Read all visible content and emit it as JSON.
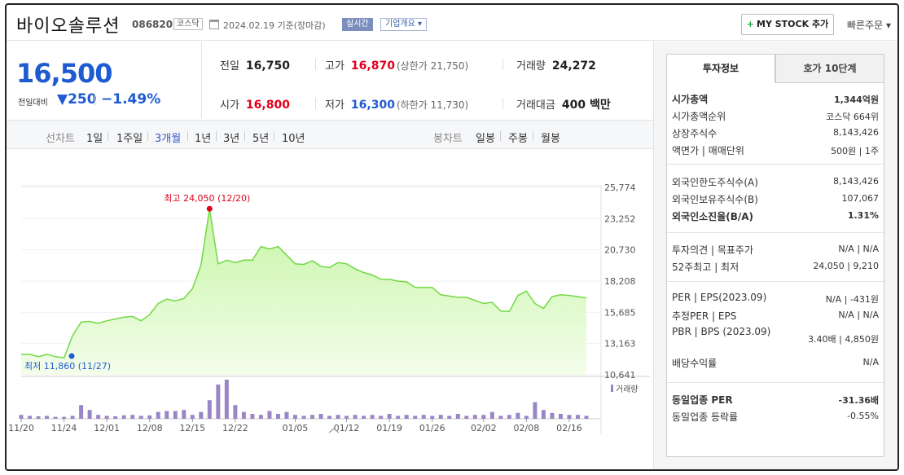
{
  "header": {
    "name": "바이오솔루션",
    "code": "086820",
    "market": "코스닥",
    "date": "2024.02.19  기준(장마감)",
    "realtime": "실시간",
    "overview": "기업개요 ▾",
    "mystock": "MY STOCK 추가",
    "quick_order": "빠른주문 ▾"
  },
  "price": {
    "current": "16,500",
    "change_label": "전일대비",
    "change": "▼250",
    "change_pct": "−1.49%"
  },
  "stats": {
    "prev_close": {
      "label": "전일",
      "value": "16,750"
    },
    "high": {
      "label": "고가",
      "value": "16,870",
      "sub": "(상한가 21,750)"
    },
    "volume": {
      "label": "거래량",
      "value": "24,272"
    },
    "open": {
      "label": "시가",
      "value": "16,800"
    },
    "low": {
      "label": "저가",
      "value": "16,300",
      "sub": "(하한가 11,730)"
    },
    "trade_value": {
      "label": "거래대금",
      "value": "400 백만"
    }
  },
  "periods": {
    "line_label": "선차트",
    "line": [
      "1일",
      "1주일",
      "3개월",
      "1년",
      "3년",
      "5년",
      "10년"
    ],
    "selected": "3개월",
    "candle_label": "봉차트",
    "candle": [
      "일봉",
      "주봉",
      "월봉"
    ]
  },
  "colors": {
    "up": "#e0001b",
    "down": "#1e5bd1",
    "area_fill": "#c6f5a4",
    "area_line": "#72d844",
    "volume_bar": "#9a86c6"
  },
  "chart_data": {
    "type": "area",
    "y_ticks": [
      "25,774",
      "23,252",
      "20,730",
      "18,208",
      "15,685",
      "13,163",
      "10,641"
    ],
    "ylim": [
      10641,
      25774
    ],
    "x_ticks": [
      "11/20",
      "11/24",
      "12/01",
      "12/08",
      "12/15",
      "12/22",
      "01/05",
      "01/12",
      "01/19",
      "01/26",
      "02/02",
      "02/08",
      "02/16"
    ],
    "max_label": "최고 24,050 (12/20)",
    "min_label": "최저 11,860 (11/27)",
    "volume_label": "거래량",
    "prices": [
      12300,
      12300,
      12100,
      12300,
      12100,
      12000,
      13800,
      14900,
      14950,
      14800,
      15000,
      15150,
      15300,
      15350,
      15000,
      15500,
      16400,
      16750,
      16600,
      16800,
      17600,
      19500,
      24050,
      19600,
      19900,
      19700,
      19900,
      19900,
      21000,
      20800,
      21000,
      20300,
      19600,
      19550,
      19850,
      19400,
      19300,
      19700,
      19600,
      19200,
      18900,
      18700,
      18350,
      18350,
      18200,
      18150,
      17700,
      17700,
      17700,
      17100,
      17000,
      16900,
      16900,
      16650,
      16400,
      16500,
      15800,
      15750,
      17050,
      17400,
      16400,
      16000,
      16950,
      17100,
      17050,
      16950,
      16850
    ],
    "volumes": [
      8,
      6,
      5,
      6,
      4,
      4,
      6,
      28,
      18,
      8,
      6,
      5,
      7,
      8,
      6,
      7,
      14,
      16,
      16,
      18,
      8,
      14,
      38,
      70,
      80,
      28,
      14,
      10,
      8,
      16,
      10,
      14,
      8,
      6,
      8,
      10,
      6,
      8,
      6,
      8,
      6,
      8,
      6,
      10,
      6,
      8,
      6,
      8,
      6,
      8,
      6,
      10,
      6,
      8,
      8,
      14,
      6,
      8,
      12,
      6,
      34,
      18,
      12,
      10,
      8,
      8,
      6
    ]
  },
  "invest": {
    "tab_active": "투자정보",
    "tab_other": "호가 10단계",
    "g1": [
      {
        "k": "시가총액",
        "v": "1,344억원"
      },
      {
        "k": "시가총액순위",
        "v": "코스닥 664위"
      },
      {
        "k": "상장주식수",
        "v": "8,143,426"
      },
      {
        "k": "액면가 | 매매단위",
        "v": "500원 | 1주"
      }
    ],
    "g2": [
      {
        "k": "외국인한도주식수(A)",
        "v": "8,143,426"
      },
      {
        "k": "외국인보유주식수(B)",
        "v": "107,067"
      },
      {
        "k": "외국인소진율(B/A)",
        "v": "1.31%"
      }
    ],
    "g3": [
      {
        "k": "투자의견 | 목표주가",
        "v": "N/A | N/A"
      },
      {
        "k": "52주최고 | 최저",
        "v": "24,050 | 9,210"
      }
    ],
    "g4": [
      {
        "k": "PER | EPS(2023.09)",
        "v": "N/A | -431원"
      },
      {
        "k": "추정PER | EPS",
        "v": "N/A | N/A"
      },
      {
        "k": "PBR | BPS (2023.09)",
        "v": "3.40배 | 4,850원"
      },
      {
        "k": "배당수익률",
        "v": "N/A"
      }
    ],
    "g5": [
      {
        "k": "동일업종 PER",
        "v": "-31.36배"
      },
      {
        "k": "동일업종 등락률",
        "v": "-0.55%"
      }
    ]
  }
}
